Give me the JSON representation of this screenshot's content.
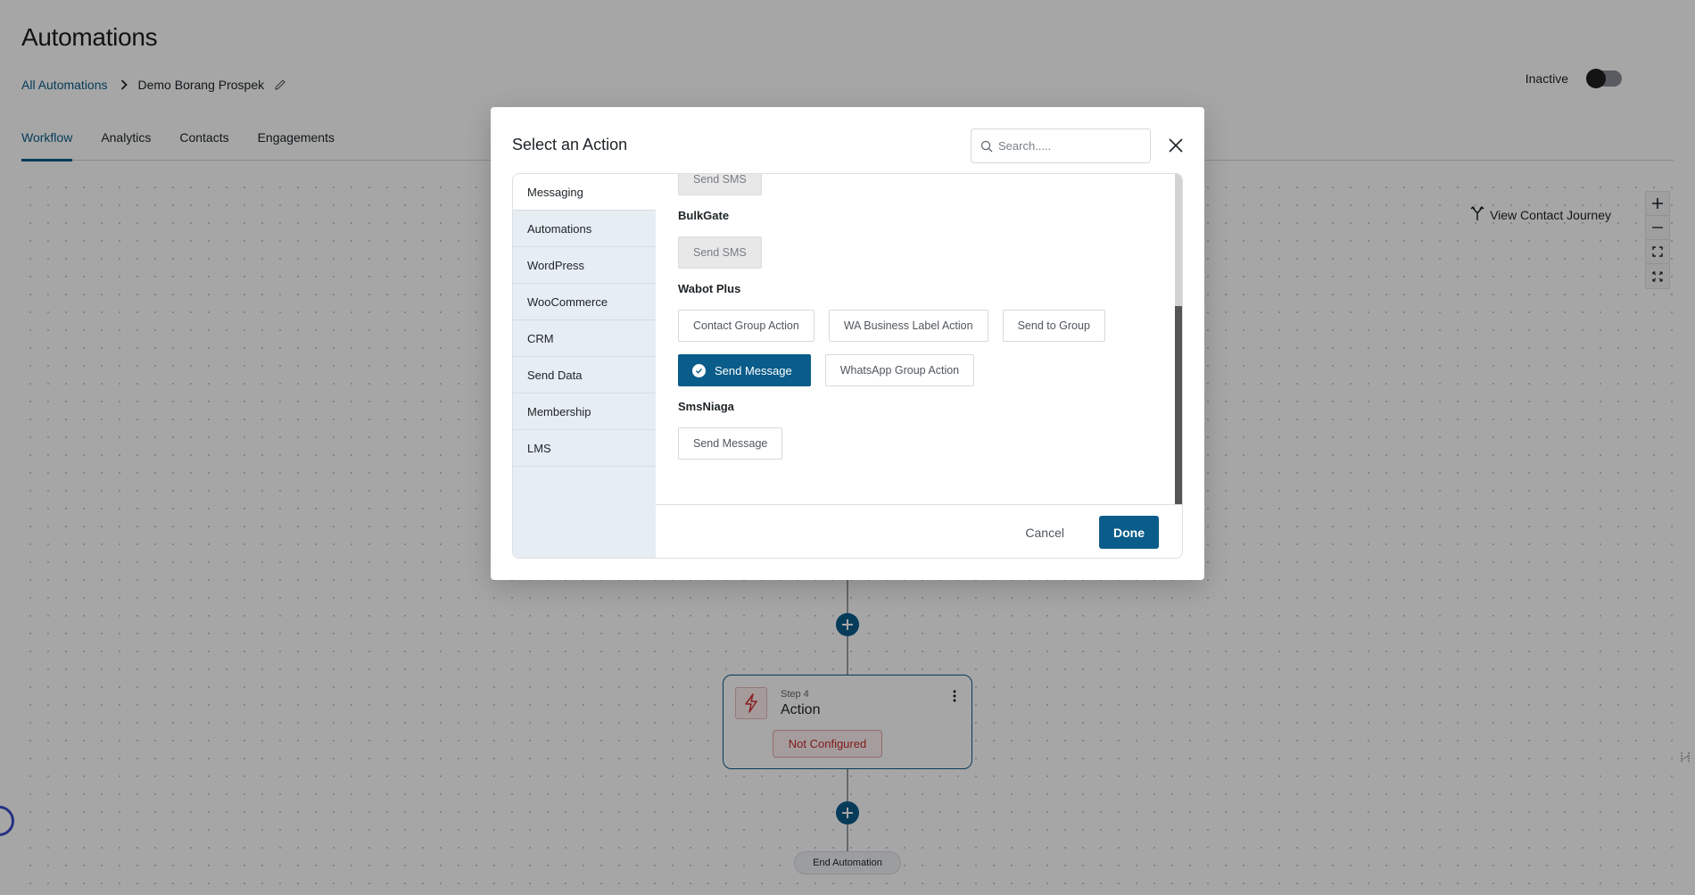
{
  "header": {
    "title": "Automations",
    "breadcrumb": {
      "root": "All Automations",
      "current": "Demo Borang Prospek"
    },
    "status_label": "Inactive",
    "status_active": false
  },
  "tabs": [
    {
      "label": "Workflow",
      "active": true
    },
    {
      "label": "Analytics",
      "active": false
    },
    {
      "label": "Contacts",
      "active": false
    },
    {
      "label": "Engagements",
      "active": false
    }
  ],
  "canvas": {
    "view_journey_label": "View Contact Journey",
    "zoom_controls": [
      "zoom-in",
      "zoom-out",
      "fit-view",
      "fullscreen"
    ],
    "step": {
      "label": "Step 4",
      "title": "Action",
      "status": "Not Configured"
    },
    "end_label": "End Automation"
  },
  "modal": {
    "title": "Select an Action",
    "search_placeholder": "Search.....",
    "search_value": "",
    "categories": [
      {
        "label": "Messaging",
        "active": true
      },
      {
        "label": "Automations",
        "active": false
      },
      {
        "label": "WordPress",
        "active": false
      },
      {
        "label": "WooCommerce",
        "active": false
      },
      {
        "label": "CRM",
        "active": false
      },
      {
        "label": "Send Data",
        "active": false
      },
      {
        "label": "Membership",
        "active": false
      },
      {
        "label": "LMS",
        "active": false
      }
    ],
    "providers": [
      {
        "name": "",
        "actions": [
          {
            "label": "Send SMS",
            "state": "disabled"
          }
        ]
      },
      {
        "name": "BulkGate",
        "actions": [
          {
            "label": "Send SMS",
            "state": "disabled"
          }
        ]
      },
      {
        "name": "Wabot Plus",
        "actions": [
          {
            "label": "Contact Group Action",
            "state": "default"
          },
          {
            "label": "WA Business Label Action",
            "state": "default"
          },
          {
            "label": "Send to Group",
            "state": "default"
          },
          {
            "label": "Send Message",
            "state": "selected"
          },
          {
            "label": "WhatsApp Group Action",
            "state": "default"
          }
        ]
      },
      {
        "name": "SmsNiaga",
        "actions": [
          {
            "label": "Send Message",
            "state": "default"
          }
        ]
      }
    ],
    "scroll_position_fraction": 0.4,
    "cancel_label": "Cancel",
    "done_label": "Done"
  },
  "colors": {
    "brand": "#0a5c8a",
    "error": "#c62828",
    "category_bg": "#e6edf3"
  }
}
